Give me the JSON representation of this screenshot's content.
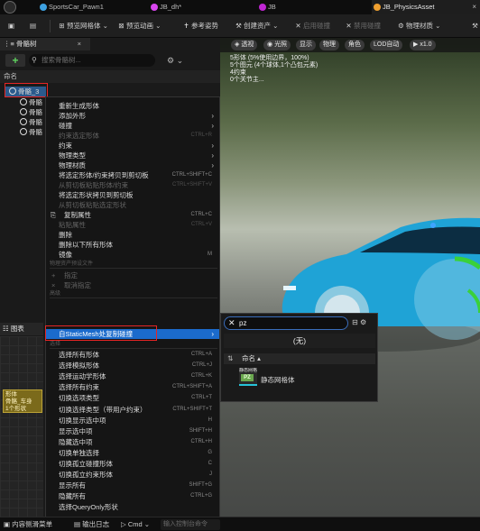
{
  "tabs": [
    {
      "label": "SportsCar_Pawn1",
      "icon": "blueprint-icon",
      "color": "#f0a030"
    },
    {
      "label": "JB_dh*",
      "icon": "anim-icon",
      "color": "#d946ef"
    },
    {
      "label": "JB",
      "icon": "skeleton-icon",
      "color": "#c026d3"
    },
    {
      "label": "JB_PhysicsAsset",
      "icon": "physics-asset-icon",
      "color": "#f0a030",
      "close": "×"
    }
  ],
  "toolbar": {
    "preview_mesh": "预览网格体",
    "preview_anim": "预览动画",
    "ref_pose": "参考姿势",
    "create_asset": "创建资产",
    "enable_collision": "启用碰撞",
    "disable_collision": "禁用碰撞",
    "physical_material": "物理材质"
  },
  "left": {
    "panel_title": "骨骼树",
    "panel_close": "×",
    "search_placeholder": "搜索骨骼树...",
    "column_name": "命名",
    "tree": [
      "骨骼_3",
      "骨骼",
      "骨骼",
      "骨骼",
      "骨骼"
    ],
    "graph_tab": "图表",
    "node_lines": [
      "形体",
      "骨骼_车身",
      "1个形状"
    ]
  },
  "viewport": {
    "buttons": [
      "透视",
      "光照",
      "显示",
      "物理",
      "角色",
      "LOD自动",
      "x1.0"
    ],
    "stats": [
      "5形体 (5%使用边界，100%)",
      "5个图元 (4个球体,1个凸包元素)",
      "4约束",
      "0个关节主..."
    ]
  },
  "menu": {
    "items": [
      {
        "label": "重新生成形体",
        "shortcut": "",
        "arrow": false,
        "disabled": false
      },
      {
        "label": "添加外形",
        "shortcut": "",
        "arrow": true,
        "disabled": false
      },
      {
        "label": "碰撞",
        "shortcut": "",
        "arrow": true,
        "disabled": false
      },
      {
        "label": "约束选定形体",
        "shortcut": "CTRL+R",
        "arrow": false,
        "disabled": true
      },
      {
        "label": "约束",
        "shortcut": "",
        "arrow": true,
        "disabled": false
      },
      {
        "label": "物理类型",
        "shortcut": "",
        "arrow": true,
        "disabled": false
      },
      {
        "label": "物理材质",
        "shortcut": "",
        "arrow": true,
        "disabled": false
      },
      {
        "label": "将选定形体/约束拷贝到剪切板",
        "shortcut": "CTRL+SHIFT+C",
        "arrow": false,
        "disabled": false
      },
      {
        "label": "从剪切板粘贴形体/约束",
        "shortcut": "CTRL+SHIFT+V",
        "arrow": false,
        "disabled": true
      },
      {
        "label": "将选定形状拷贝到剪切板",
        "shortcut": "",
        "arrow": false,
        "disabled": false
      },
      {
        "label": "从剪切板粘贴选定形状",
        "shortcut": "",
        "arrow": false,
        "disabled": true
      },
      {
        "label": "复制属性",
        "shortcut": "CTRL+C",
        "arrow": false,
        "disabled": false
      },
      {
        "label": "粘贴属性",
        "shortcut": "CTRL+V",
        "arrow": false,
        "disabled": true
      },
      {
        "label": "删除",
        "shortcut": "",
        "arrow": false,
        "disabled": false
      },
      {
        "label": "删除以下所有形体",
        "shortcut": "",
        "arrow": false,
        "disabled": false
      },
      {
        "label": "镜像",
        "shortcut": "M",
        "arrow": false,
        "disabled": false
      }
    ],
    "section_profile": "物理资产预设文件",
    "assign": "指定",
    "unassign": "取消指定",
    "section_adv": "高级",
    "highlight": "自StaticMesh处复制碰撞",
    "section_select": "选择",
    "select_items": [
      {
        "label": "选择所有形体",
        "shortcut": "CTRL+A"
      },
      {
        "label": "选择模拟形体",
        "shortcut": "CTRL+J"
      },
      {
        "label": "选择运动学形体",
        "shortcut": "CTRL+K"
      },
      {
        "label": "选择所有约束",
        "shortcut": "CTRL+SHIFT+A"
      },
      {
        "label": "切换选项类型",
        "shortcut": "CTRL+T"
      },
      {
        "label": "切换选择类型（带用户约束）",
        "shortcut": "CTRL+SHIFT+T"
      },
      {
        "label": "切换显示选中项",
        "shortcut": "H"
      },
      {
        "label": "显示选中项",
        "shortcut": "SHIFT+H"
      },
      {
        "label": "隐藏选中项",
        "shortcut": "CTRL+H"
      },
      {
        "label": "切换单独选择",
        "shortcut": "G"
      },
      {
        "label": "切换孤立碰撞形体",
        "shortcut": "C"
      },
      {
        "label": "切换孤立约束形体",
        "shortcut": "J"
      },
      {
        "label": "显示所有",
        "shortcut": "SHIFT+G"
      },
      {
        "label": "隐藏所有",
        "shortcut": "CTRL+G"
      },
      {
        "label": "选择QueryOnly形状",
        "shortcut": ""
      }
    ]
  },
  "submenu": {
    "search_value": "pz",
    "none_label": "(无)",
    "column_name": "命名",
    "item_name": "静态网格体",
    "thumb_label": "静态网格体",
    "thumb_text": "PZ"
  },
  "bottom": {
    "content_drawer": "内容侧滑菜单",
    "output_log": "输出日志",
    "cmd": "Cmd",
    "cmd_placeholder": "输入控制台命令"
  }
}
